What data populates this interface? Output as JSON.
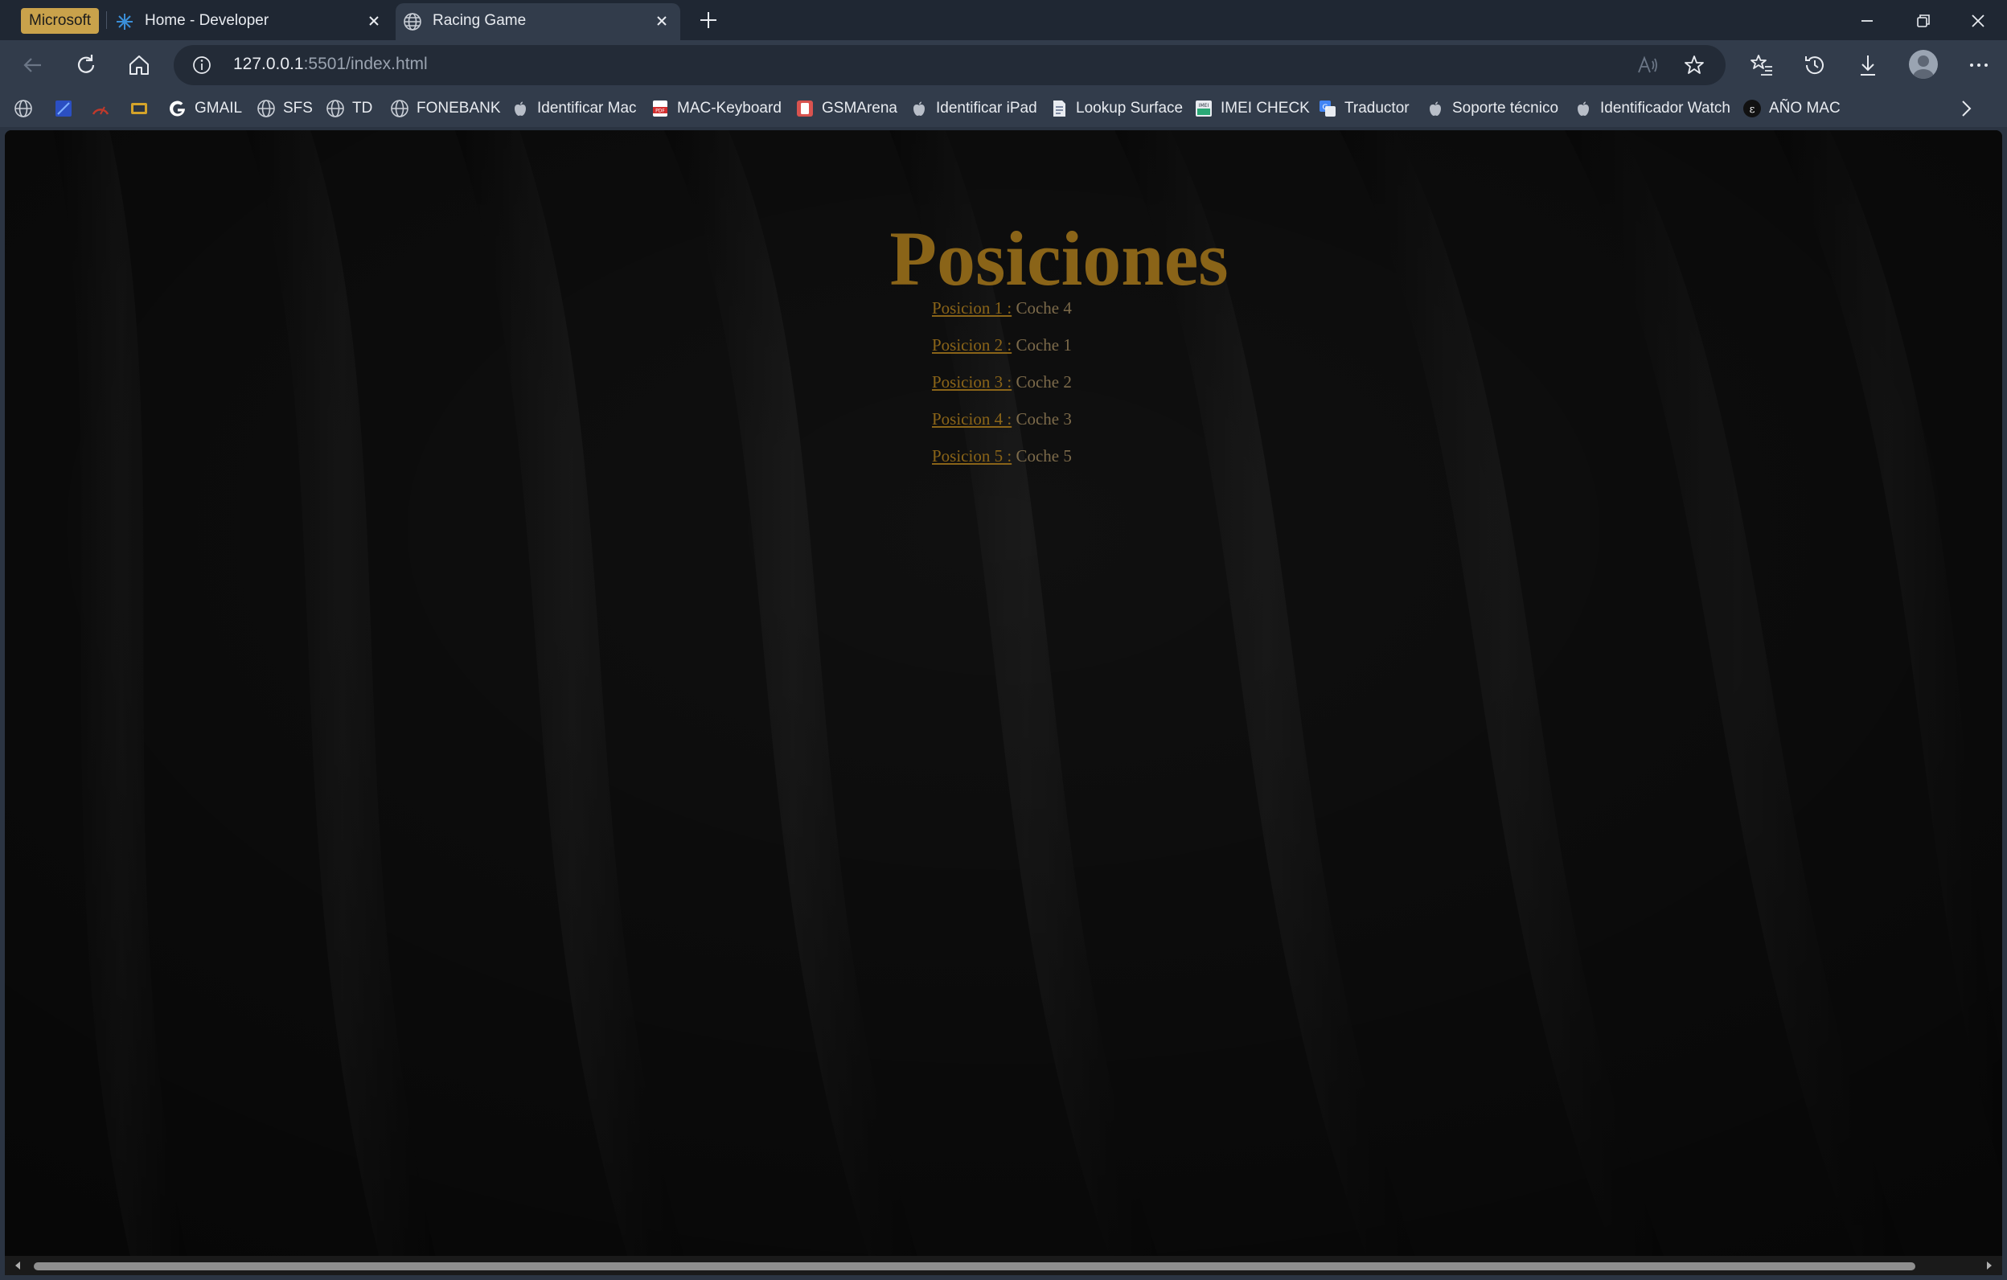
{
  "profile": {
    "label": "Microsoft"
  },
  "tabs": [
    {
      "title": "Home - Developer",
      "active": false
    },
    {
      "title": "Racing Game",
      "active": true
    }
  ],
  "address": {
    "host": "127.0.0.1",
    "rest": ":5501/index.html"
  },
  "favorites": [
    {
      "label": "",
      "icon": "globe-icon"
    },
    {
      "label": "",
      "icon": "app-blue-icon"
    },
    {
      "label": "",
      "icon": "speed-gauge-icon"
    },
    {
      "label": "",
      "icon": "mb-icon"
    },
    {
      "label": "GMAIL",
      "icon": "google-icon"
    },
    {
      "label": "SFS",
      "icon": "globe-icon"
    },
    {
      "label": "TD",
      "icon": "globe-icon"
    },
    {
      "label": "FONEBANK",
      "icon": "globe-icon"
    },
    {
      "label": "Identificar Mac",
      "icon": "apple-icon"
    },
    {
      "label": "MAC-Keyboard",
      "icon": "pdf-icon"
    },
    {
      "label": "GSMArena",
      "icon": "gsmarena-icon"
    },
    {
      "label": "Identificar iPad",
      "icon": "apple-icon"
    },
    {
      "label": "Lookup Surface",
      "icon": "document-icon"
    },
    {
      "label": "IMEI CHECK",
      "icon": "imei-icon"
    },
    {
      "label": "Traductor",
      "icon": "translate-icon"
    },
    {
      "label": "Soporte técnico",
      "icon": "apple-icon"
    },
    {
      "label": "Identificador Watch",
      "icon": "apple-icon"
    },
    {
      "label": "AÑO MAC",
      "icon": "mac-year-icon"
    }
  ],
  "page": {
    "title": "Posiciones",
    "positions": [
      {
        "label": "Posicion 1 :",
        "value": "Coche 4"
      },
      {
        "label": "Posicion 2 :",
        "value": "Coche 1"
      },
      {
        "label": "Posicion 3 :",
        "value": "Coche 2"
      },
      {
        "label": "Posicion 4 :",
        "value": "Coche 3"
      },
      {
        "label": "Posicion 5 :",
        "value": "Coche 5"
      }
    ]
  },
  "colors": {
    "title": "#8a6418",
    "link": "#8a6418",
    "background": "#0e0e0e",
    "chrome": "#323c4b"
  }
}
